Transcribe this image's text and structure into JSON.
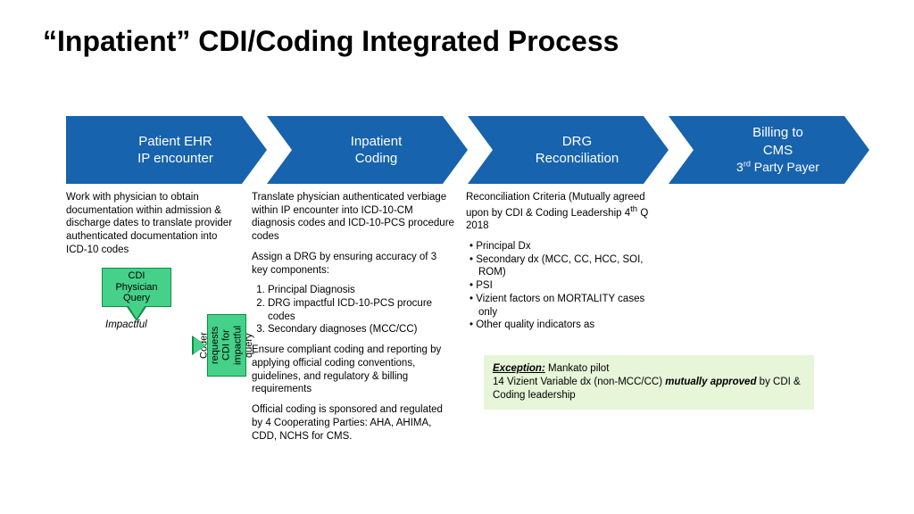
{
  "title": "“Inpatient” CDI/Coding Integrated Process",
  "arrows": {
    "a1": {
      "l1": "Patient EHR",
      "l2": "IP encounter"
    },
    "a2": {
      "l1": "Inpatient",
      "l2": "Coding"
    },
    "a3": {
      "l1": "DRG",
      "l2": "Reconciliation"
    },
    "a4": {
      "l1": "Billing to",
      "l2": "CMS",
      "l3_pre": "3",
      "l3_sup": "rd",
      "l3_post": " Party Payer"
    }
  },
  "col1": {
    "p1": "Work with physician to obtain documentation within admission & discharge dates  to translate provider authenticated documentation into ICD-10 codes"
  },
  "callouts": {
    "cdi": "CDI Physician Query",
    "impactful": "Impactful",
    "coder": "Coder requests CDI for impactful query"
  },
  "col2": {
    "p1": "Translate physician authenticated verbiage within IP encounter into ICD-10-CM diagnosis codes and ICD-10-PCS procedure codes",
    "p2": "Assign a DRG by ensuring accuracy of 3 key components:",
    "li1": "Principal Diagnosis",
    "li2": "DRG impactful ICD-10-PCS procure codes",
    "li3": "Secondary diagnoses (MCC/CC)",
    "p3": "Ensure compliant coding and reporting by applying official coding conventions, guidelines, and regulatory & billing requirements",
    "p4": "Official coding is sponsored and regulated by 4 Cooperating Parties: AHA, AHIMA, CDD, NCHS for CMS."
  },
  "col3": {
    "p1_pre": "Reconciliation Criteria (Mutually agreed upon by CDI & Coding Leadership 4",
    "p1_sup": "th",
    "p1_post": " Q 2018",
    "li1": "Principal Dx",
    "li2": "Secondary dx (MCC, CC, HCC, SOI, ROM)",
    "li3": "PSI",
    "li4": "Vizient factors on MORTALITY cases only",
    "li5": "Other quality indicators as"
  },
  "exception": {
    "hdr": "Exception:",
    "rest1": "  Mankato pilot",
    "line2a": "14 Vizient Variable dx (non-MCC/CC) ",
    "ma": "mutually approved",
    "line2b": " by CDI & Coding leadership"
  }
}
